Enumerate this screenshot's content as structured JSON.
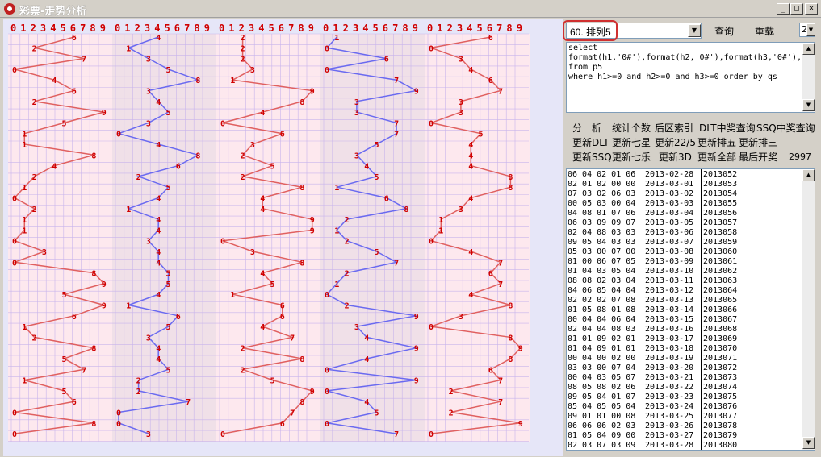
{
  "window": {
    "title": "彩票-走势分析",
    "min": "_",
    "max": "□",
    "close": "×"
  },
  "digits": [
    "0",
    "1",
    "2",
    "3",
    "4",
    "5",
    "6",
    "7",
    "8",
    "9"
  ],
  "chart_data": {
    "type": "line",
    "x": [
      "2013052",
      "2013053",
      "2013054",
      "2013055",
      "2013056",
      "2013057",
      "2013058",
      "2013059",
      "2013060",
      "2013061",
      "2013062",
      "2013063",
      "2013064",
      "2013065",
      "2013066",
      "2013067",
      "2013068",
      "2013069",
      "2013070",
      "2013071",
      "2013072",
      "2013073",
      "2013074",
      "2013075",
      "2013076",
      "2013077",
      "2013078",
      "2013079",
      "2013080"
    ],
    "series": [
      {
        "values": [
          6,
          2,
          7,
          0,
          4,
          6,
          2,
          9,
          5,
          1,
          1,
          8,
          4,
          2,
          1,
          0,
          2,
          1,
          1,
          0,
          3,
          0,
          8,
          9,
          5,
          9,
          6,
          1,
          2,
          8,
          5,
          7,
          1,
          5,
          6,
          0,
          8,
          0
        ]
      },
      {
        "values": [
          4,
          1,
          3,
          5,
          8,
          3,
          4,
          5,
          3,
          0,
          4,
          8,
          6,
          2,
          5,
          4,
          1,
          4,
          4,
          3,
          4,
          4,
          5,
          5,
          4,
          1,
          6,
          5,
          3,
          4,
          4,
          5,
          2,
          2,
          7,
          0,
          0,
          3
        ]
      },
      {
        "values": [
          2,
          2,
          2,
          3,
          1,
          9,
          8,
          4,
          0,
          6,
          3,
          2,
          5,
          2,
          8,
          4,
          4,
          9,
          9,
          0,
          3,
          8,
          4,
          5,
          1,
          6,
          6,
          4,
          7,
          2,
          8,
          2,
          5,
          9,
          8,
          7,
          6,
          0
        ]
      },
      {
        "values": [
          1,
          0,
          6,
          0,
          7,
          9,
          3,
          3,
          7,
          7,
          5,
          3,
          4,
          5,
          1,
          6,
          8,
          2,
          1,
          2,
          5,
          7,
          2,
          1,
          0,
          2,
          9,
          3,
          4,
          9,
          4,
          0,
          9,
          0,
          4,
          5,
          0,
          7
        ]
      },
      {
        "values": [
          6,
          0,
          3,
          4,
          6,
          7,
          3,
          3,
          0,
          5,
          4,
          4,
          4,
          8,
          8,
          4,
          3,
          1,
          1,
          0,
          4,
          7,
          6,
          7,
          4,
          8,
          3,
          0,
          8,
          9,
          8,
          6,
          7,
          2,
          7,
          2,
          9,
          0
        ]
      }
    ]
  },
  "query": {
    "selected": "60. 排列5",
    "query_btn": "查询",
    "repeat_label": "重载",
    "repeat_value": "2"
  },
  "sql": {
    "line1": "select",
    "line2": "format(h1,'0#'),format(h2,'0#'),format(h3,'0#'),f",
    "line3": "from p5",
    "line4": "where h1>=0 and h2>=0 and h3>=0 order by qs"
  },
  "buttons": {
    "row1": [
      "分　析",
      "统计个数",
      "后区索引",
      "DLT中奖查询",
      "SSQ中奖查询"
    ],
    "row2": [
      "更新DLT",
      "更新七星",
      "更新22/5",
      "更新排五",
      "更新排三"
    ],
    "row3": [
      "更新SSQ",
      "更新七乐",
      "更新3D",
      "更新全部",
      "最后开奖"
    ],
    "count": "2997"
  },
  "rows": [
    [
      "06 04 02 01 06",
      "2013-02-28",
      "2013052"
    ],
    [
      "02 01 02 00 00",
      "2013-03-01",
      "2013053"
    ],
    [
      "07 03 02 06 03",
      "2013-03-02",
      "2013054"
    ],
    [
      "00 05 03 00 04",
      "2013-03-03",
      "2013055"
    ],
    [
      "04 08 01 07 06",
      "2013-03-04",
      "2013056"
    ],
    [
      "06 03 09 09 07",
      "2013-03-05",
      "2013057"
    ],
    [
      "02 04 08 03 03",
      "2013-03-06",
      "2013058"
    ],
    [
      "09 05 04 03 03",
      "2013-03-07",
      "2013059"
    ],
    [
      "05 03 00 07 00",
      "2013-03-08",
      "2013060"
    ],
    [
      "01 00 06 07 05",
      "2013-03-09",
      "2013061"
    ],
    [
      "01 04 03 05 04",
      "2013-03-10",
      "2013062"
    ],
    [
      "08 08 02 03 04",
      "2013-03-11",
      "2013063"
    ],
    [
      "04 06 05 04 04",
      "2013-03-12",
      "2013064"
    ],
    [
      "02 02 02 07 08",
      "2013-03-13",
      "2013065"
    ],
    [
      "01 05 08 01 08",
      "2013-03-14",
      "2013066"
    ],
    [
      "00 04 04 06 04",
      "2013-03-15",
      "2013067"
    ],
    [
      "02 04 04 08 03",
      "2013-03-16",
      "2013068"
    ],
    [
      "01 01 09 02 01",
      "2013-03-17",
      "2013069"
    ],
    [
      "01 04 09 01 01",
      "2013-03-18",
      "2013070"
    ],
    [
      "00 04 00 02 00",
      "2013-03-19",
      "2013071"
    ],
    [
      "03 03 00 07 04",
      "2013-03-20",
      "2013072"
    ],
    [
      "00 04 03 05 07",
      "2013-03-21",
      "2013073"
    ],
    [
      "08 05 08 02 06",
      "2013-03-22",
      "2013074"
    ],
    [
      "09 05 04 01 07",
      "2013-03-23",
      "2013075"
    ],
    [
      "05 04 05 05 04",
      "2013-03-24",
      "2013076"
    ],
    [
      "09 01 01 00 08",
      "2013-03-25",
      "2013077"
    ],
    [
      "06 06 06 02 03",
      "2013-03-26",
      "2013078"
    ],
    [
      "01 05 04 09 00",
      "2013-03-27",
      "2013079"
    ],
    [
      "02 03 07 03 09",
      "2013-03-28",
      "2013080"
    ]
  ],
  "colors": {
    "red": "#e06060",
    "blue": "#6a6af0",
    "digit": "#d00000",
    "grid": "#c8b4ec",
    "cellA": "#fde8ee",
    "cellB": "#f0e0e8"
  }
}
